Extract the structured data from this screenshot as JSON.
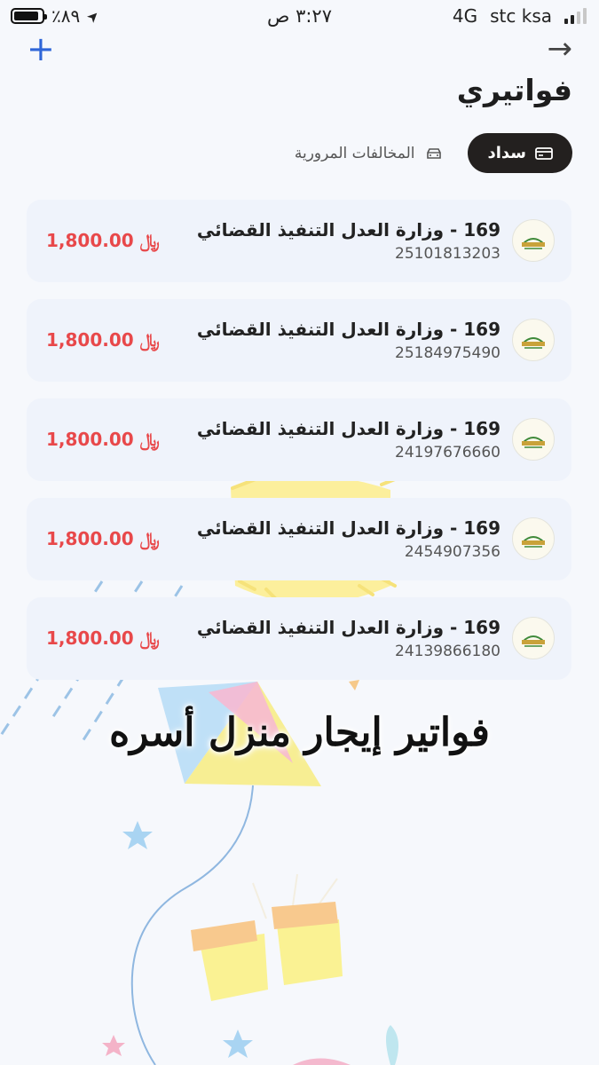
{
  "status_bar": {
    "battery_text": "٪٨٩",
    "battery_level": 0.89,
    "time": "٣:٢٧ ص",
    "network": "4G",
    "carrier": "stc ksa"
  },
  "header": {
    "add_icon": "plus-icon",
    "forward_icon": "arrow-right-icon",
    "title": "فواتيري"
  },
  "tabs": [
    {
      "label": "سداد",
      "icon": "credit-card-icon",
      "active": true
    },
    {
      "label": "المخالفات المرورية",
      "icon": "car-icon",
      "active": false
    }
  ],
  "bills": [
    {
      "name": "169 - وزارة العدل التنفيذ القضائي",
      "number": "25101813203",
      "amount": "1,800.00 ﷼"
    },
    {
      "name": "169 - وزارة العدل التنفيذ القضائي",
      "number": "25184975490",
      "amount": "1,800.00 ﷼"
    },
    {
      "name": "169 - وزارة العدل التنفيذ القضائي",
      "number": "24197676660",
      "amount": "1,800.00 ﷼"
    },
    {
      "name": "169 - وزارة العدل التنفيذ القضائي",
      "number": "2454907356",
      "amount": "1,800.00 ﷼"
    },
    {
      "name": "169 - وزارة العدل التنفيذ القضائي",
      "number": "24139866180",
      "amount": "1,800.00 ﷼"
    }
  ],
  "overlay_caption": "فواتير إيجار منزل أسره",
  "colors": {
    "accent": "#2f66d8",
    "amount": "#e8484a",
    "active_tab": "#23201f",
    "card_bg": "#eff3fb"
  }
}
